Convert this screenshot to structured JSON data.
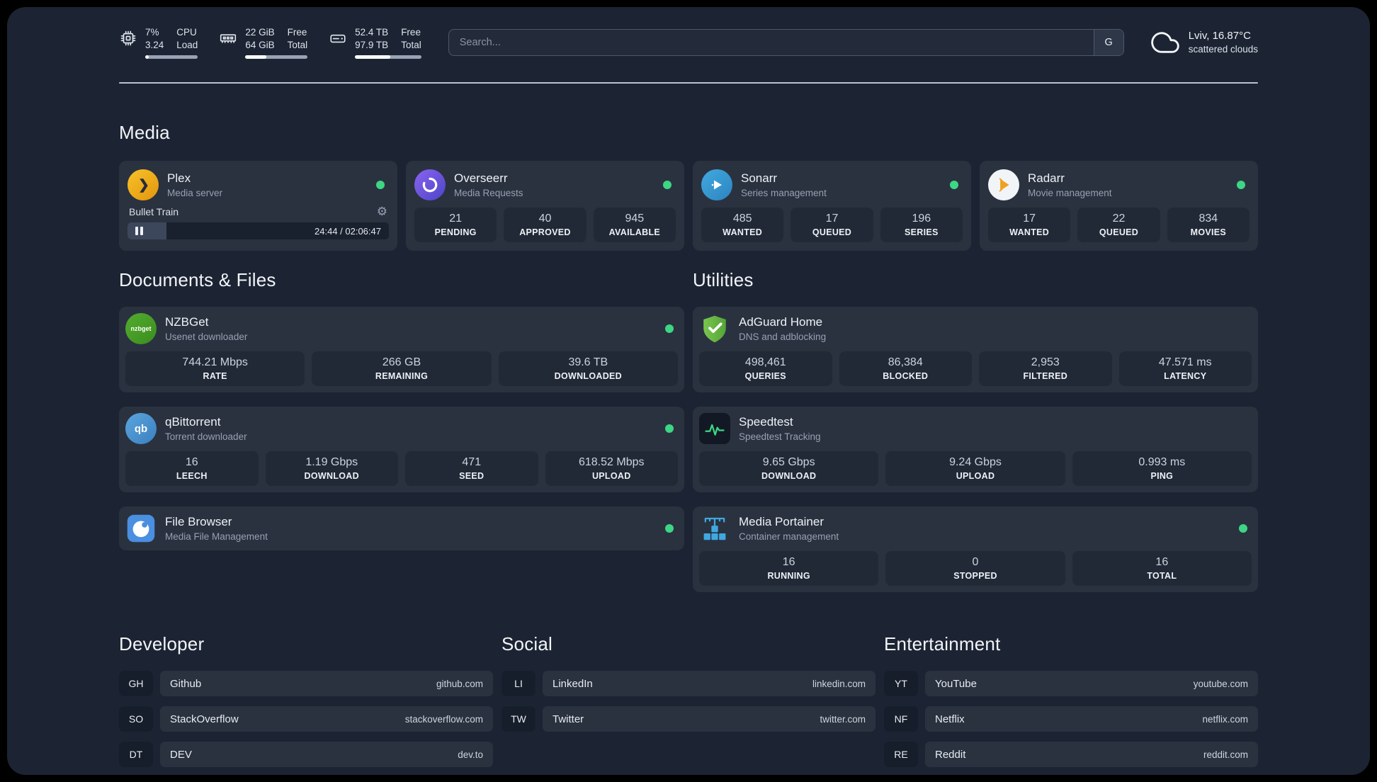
{
  "topbar": {
    "cpu": {
      "v1": "7%",
      "v2": "3.24",
      "l1": "CPU",
      "l2": "Load",
      "progress": 7
    },
    "ram": {
      "v1": "22 GiB",
      "v2": "64 GiB",
      "l1": "Free",
      "l2": "Total",
      "progress": 34
    },
    "disk": {
      "v1": "52.4 TB",
      "v2": "97.9 TB",
      "l1": "Free",
      "l2": "Total",
      "progress": 53
    },
    "search": {
      "placeholder": "Search...",
      "provider": "G"
    },
    "weather": {
      "location": "Lviv, 16.87°C",
      "condition": "scattered clouds"
    }
  },
  "sections": {
    "media": "Media",
    "documents": "Documents & Files",
    "utilities": "Utilities",
    "developer": "Developer",
    "social": "Social",
    "entertainment": "Entertainment"
  },
  "cards": {
    "plex": {
      "title": "Plex",
      "subtitle": "Media server",
      "track": "Bullet Train",
      "time": "24:44 / 02:06:47",
      "progress": 15,
      "gear_icon": "⚙"
    },
    "overseerr": {
      "title": "Overseerr",
      "subtitle": "Media Requests",
      "stats": [
        {
          "v": "21",
          "l": "PENDING"
        },
        {
          "v": "40",
          "l": "APPROVED"
        },
        {
          "v": "945",
          "l": "AVAILABLE"
        }
      ]
    },
    "sonarr": {
      "title": "Sonarr",
      "subtitle": "Series management",
      "stats": [
        {
          "v": "485",
          "l": "WANTED"
        },
        {
          "v": "17",
          "l": "QUEUED"
        },
        {
          "v": "196",
          "l": "SERIES"
        }
      ]
    },
    "radarr": {
      "title": "Radarr",
      "subtitle": "Movie management",
      "stats": [
        {
          "v": "17",
          "l": "WANTED"
        },
        {
          "v": "22",
          "l": "QUEUED"
        },
        {
          "v": "834",
          "l": "MOVIES"
        }
      ]
    },
    "nzbget": {
      "title": "NZBGet",
      "subtitle": "Usenet downloader",
      "icon_text": "nzbget",
      "stats": [
        {
          "v": "744.21 Mbps",
          "l": "RATE"
        },
        {
          "v": "266 GB",
          "l": "REMAINING"
        },
        {
          "v": "39.6 TB",
          "l": "DOWNLOADED"
        }
      ]
    },
    "qbittorrent": {
      "title": "qBittorrent",
      "subtitle": "Torrent downloader",
      "icon_text": "qb",
      "stats": [
        {
          "v": "16",
          "l": "LEECH"
        },
        {
          "v": "1.19 Gbps",
          "l": "DOWNLOAD"
        },
        {
          "v": "471",
          "l": "SEED"
        },
        {
          "v": "618.52 Mbps",
          "l": "UPLOAD"
        }
      ]
    },
    "filebrowser": {
      "title": "File Browser",
      "subtitle": "Media File Management"
    },
    "adguard": {
      "title": "AdGuard Home",
      "subtitle": "DNS and adblocking",
      "stats": [
        {
          "v": "498,461",
          "l": "QUERIES"
        },
        {
          "v": "86,384",
          "l": "BLOCKED"
        },
        {
          "v": "2,953",
          "l": "FILTERED"
        },
        {
          "v": "47.571 ms",
          "l": "LATENCY"
        }
      ]
    },
    "speedtest": {
      "title": "Speedtest",
      "subtitle": "Speedtest Tracking",
      "stats": [
        {
          "v": "9.65 Gbps",
          "l": "DOWNLOAD"
        },
        {
          "v": "9.24 Gbps",
          "l": "UPLOAD"
        },
        {
          "v": "0.993 ms",
          "l": "PING"
        }
      ]
    },
    "portainer": {
      "title": "Media Portainer",
      "subtitle": "Container management",
      "stats": [
        {
          "v": "16",
          "l": "RUNNING"
        },
        {
          "v": "0",
          "l": "STOPPED"
        },
        {
          "v": "16",
          "l": "TOTAL"
        }
      ]
    }
  },
  "bookmarks": {
    "developer": [
      {
        "abbr": "GH",
        "label": "Github",
        "url": "github.com"
      },
      {
        "abbr": "SO",
        "label": "StackOverflow",
        "url": "stackoverflow.com"
      },
      {
        "abbr": "DT",
        "label": "DEV",
        "url": "dev.to"
      }
    ],
    "social": [
      {
        "abbr": "LI",
        "label": "LinkedIn",
        "url": "linkedin.com"
      },
      {
        "abbr": "TW",
        "label": "Twitter",
        "url": "twitter.com"
      }
    ],
    "entertainment": [
      {
        "abbr": "YT",
        "label": "YouTube",
        "url": "youtube.com"
      },
      {
        "abbr": "NF",
        "label": "Netflix",
        "url": "netflix.com"
      },
      {
        "abbr": "RE",
        "label": "Reddit",
        "url": "reddit.com"
      }
    ]
  },
  "colors": {
    "status_online": "#3dd684",
    "background": "#1c2433",
    "card": "#2a3240"
  }
}
